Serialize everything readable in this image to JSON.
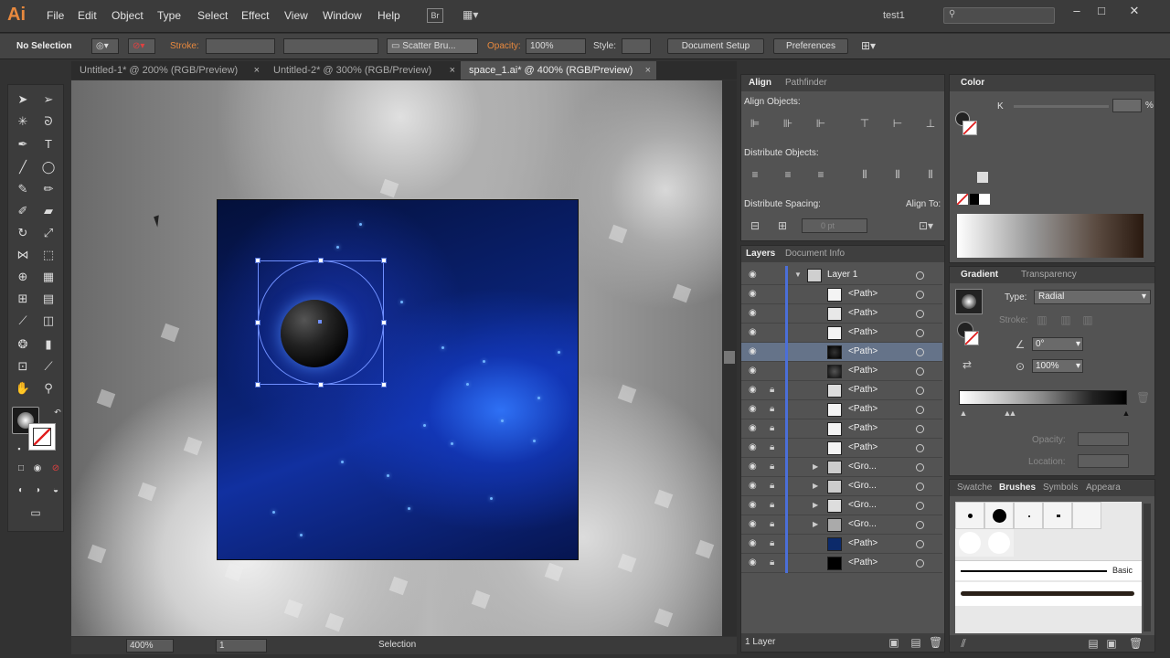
{
  "app": {
    "logo": "Ai",
    "workspace": "test1"
  },
  "menu": [
    "File",
    "Edit",
    "Object",
    "Type",
    "Select",
    "Effect",
    "View",
    "Window",
    "Help"
  ],
  "menu_extra": {
    "bridge": "Br"
  },
  "control": {
    "selection_label": "No Selection",
    "stroke_label": "Stroke:",
    "brush_value": "Scatter Bru...",
    "opacity_label": "Opacity:",
    "opacity_value": "100%",
    "style_label": "Style:",
    "document_setup": "Document Setup",
    "preferences": "Preferences"
  },
  "tabs": [
    {
      "label": "Untitled-1* @ 200% (RGB/Preview)"
    },
    {
      "label": "Untitled-2* @ 300% (RGB/Preview)"
    },
    {
      "label": "space_1.ai* @ 400% (RGB/Preview)"
    }
  ],
  "status": {
    "zoom": "400%",
    "page": "1",
    "tool": "Selection"
  },
  "align": {
    "tab_align": "Align",
    "tab_pathfinder": "Pathfinder",
    "align_objects": "Align Objects:",
    "distribute_objects": "Distribute Objects:",
    "distribute_spacing": "Distribute Spacing:",
    "align_to": "Align To:",
    "spacing_value": "0 pt"
  },
  "layers_panel": {
    "tab_layers": "Layers",
    "tab_doc_info": "Document Info",
    "footer": "1 Layer",
    "rows": [
      {
        "name": "Layer 1",
        "locked": false,
        "thumb": "#cfcfcf"
      },
      {
        "name": "<Path>",
        "locked": false,
        "thumb": "#f4f4f4"
      },
      {
        "name": "<Path>",
        "locked": false,
        "thumb": "#e8e8e8"
      },
      {
        "name": "<Path>",
        "locked": false,
        "thumb": "#f4f4f4"
      },
      {
        "name": "<Path>",
        "locked": false,
        "thumb": "#111111"
      },
      {
        "name": "<Path>",
        "locked": false,
        "thumb": "#333333"
      },
      {
        "name": "<Path>",
        "locked": true,
        "thumb": "#dddddd"
      },
      {
        "name": "<Path>",
        "locked": true,
        "thumb": "#f4f4f4"
      },
      {
        "name": "<Path>",
        "locked": true,
        "thumb": "#f4f4f4"
      },
      {
        "name": "<Path>",
        "locked": true,
        "thumb": "#f4f4f4"
      },
      {
        "name": "<Gro...",
        "locked": true,
        "thumb": "#cccccc"
      },
      {
        "name": "<Gro...",
        "locked": true,
        "thumb": "#cccccc"
      },
      {
        "name": "<Gro...",
        "locked": true,
        "thumb": "#dddddd"
      },
      {
        "name": "<Gro...",
        "locked": true,
        "thumb": "#aaaaaa"
      },
      {
        "name": "<Path>",
        "locked": true,
        "thumb": "#0c2a6a"
      },
      {
        "name": "<Path>",
        "locked": true,
        "thumb": "#000000"
      }
    ]
  },
  "color_panel": {
    "tab": "Color",
    "k_label": "K",
    "percent": "%"
  },
  "gradient_panel": {
    "tab_gradient": "Gradient",
    "tab_transparency": "Transparency",
    "type_label": "Type:",
    "type_value": "Radial",
    "stroke_label": "Stroke:",
    "angle_value": "0°",
    "ratio_value": "100%",
    "opacity_label": "Opacity:",
    "location_label": "Location:"
  },
  "brushes_panel": {
    "tabs": [
      "Swatche",
      "Brushes",
      "Symbols",
      "Appeara"
    ],
    "basic_label": "Basic"
  }
}
